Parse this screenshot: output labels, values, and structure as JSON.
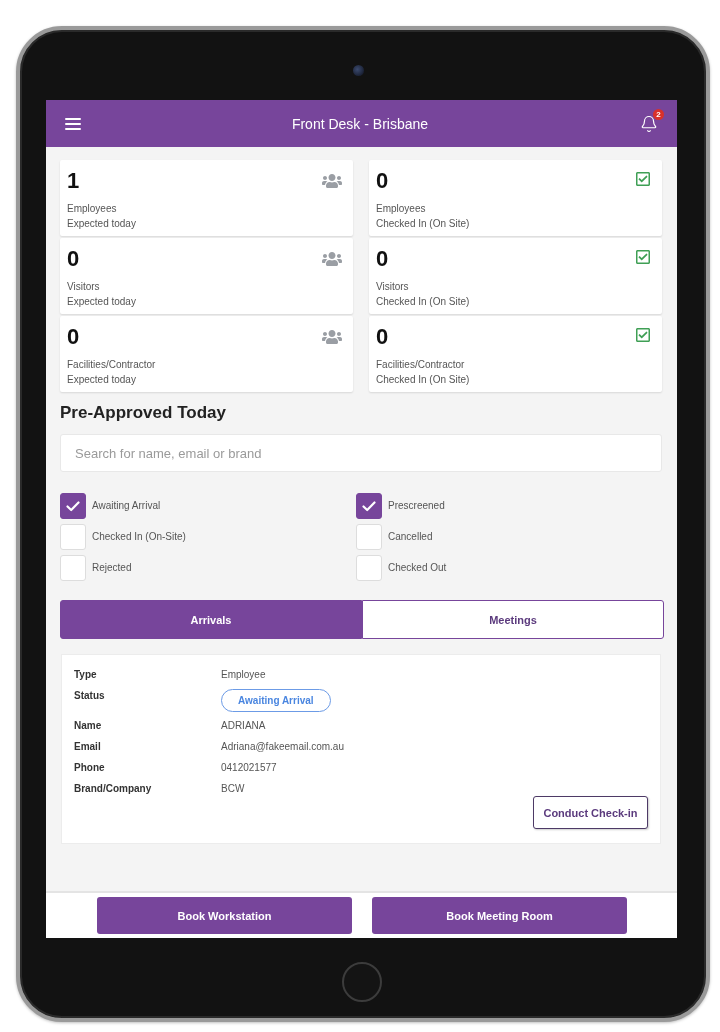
{
  "header": {
    "title": "Front Desk - Brisbane",
    "notification_count": "2"
  },
  "stats": [
    {
      "kind": "expected",
      "value": "1",
      "label": "Employees",
      "sublabel": "Expected today"
    },
    {
      "kind": "checked_in",
      "value": "0",
      "label": "Employees",
      "sublabel": "Checked In (On Site)"
    },
    {
      "kind": "expected",
      "value": "0",
      "label": "Visitors",
      "sublabel": "Expected today"
    },
    {
      "kind": "checked_in",
      "value": "0",
      "label": "Visitors",
      "sublabel": "Checked In (On Site)"
    },
    {
      "kind": "expected",
      "value": "0",
      "label": "Facilities/Contractor",
      "sublabel": "Expected today"
    },
    {
      "kind": "checked_in",
      "value": "0",
      "label": "Facilities/Contractor",
      "sublabel": "Checked In (On Site)"
    }
  ],
  "section_title": "Pre-Approved Today",
  "search": {
    "placeholder": "Search for name, email or brand"
  },
  "filters": [
    {
      "label": "Awaiting Arrival",
      "checked": true
    },
    {
      "label": "Prescreened",
      "checked": true
    },
    {
      "label": "Checked In (On-Site)",
      "checked": false
    },
    {
      "label": "Cancelled",
      "checked": false
    },
    {
      "label": "Rejected",
      "checked": false
    },
    {
      "label": "Checked Out",
      "checked": false
    }
  ],
  "tabs": [
    {
      "label": "Arrivals",
      "selected": true
    },
    {
      "label": "Meetings",
      "selected": false
    }
  ],
  "details": {
    "rows": [
      {
        "kind": "text",
        "label": "Type",
        "value": "Employee"
      },
      {
        "kind": "badge",
        "label": "Status",
        "value": "Awaiting Arrival"
      },
      {
        "kind": "text",
        "label": "Name",
        "value": "ADRIANA"
      },
      {
        "kind": "text",
        "label": "Email",
        "value": "Adriana@fakeemail.com.au"
      },
      {
        "kind": "text",
        "label": "Phone",
        "value": "0412021577"
      },
      {
        "kind": "text",
        "label": "Brand/Company",
        "value": "BCW"
      }
    ],
    "action": "Conduct Check-in"
  },
  "footer_buttons": [
    "Book Workstation",
    "Book Meeting Room"
  ]
}
